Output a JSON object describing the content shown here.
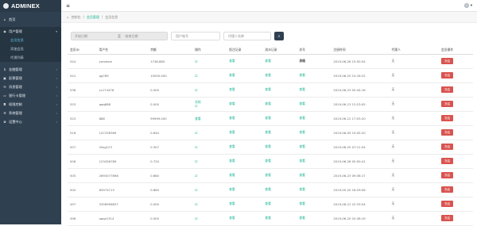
{
  "sidebar": {
    "logo": "ADMINEX",
    "items": [
      {
        "label": "首页",
        "icon": "home-icon",
        "glyph": "⌂"
      },
      {
        "label": "用户管理",
        "icon": "user-group-icon",
        "glyph": "◉",
        "chev": "▾"
      },
      {
        "label": "会员信息",
        "sub": true,
        "active": true
      },
      {
        "label": "添加会员",
        "sub": true
      },
      {
        "label": "代理列表",
        "sub": true
      },
      {
        "label": "金融管理",
        "icon": "dollar-icon",
        "glyph": "$",
        "chev": "‹"
      },
      {
        "label": "彩票管理",
        "icon": "lottery-icon",
        "glyph": "▣",
        "chev": "‹"
      },
      {
        "label": "消息管理",
        "icon": "message-icon",
        "glyph": "✉",
        "chev": "‹"
      },
      {
        "label": "银行卡管理",
        "icon": "card-icon",
        "glyph": "▭",
        "chev": "‹"
      },
      {
        "label": "权限控制",
        "icon": "lock-icon",
        "glyph": "◘",
        "chev": "‹"
      },
      {
        "label": "系统管理",
        "icon": "gear-icon",
        "glyph": "⚙",
        "chev": "‹"
      },
      {
        "label": "设置中心",
        "icon": "settings-icon",
        "glyph": "✿",
        "chev": "‹"
      }
    ]
  },
  "topbar": {
    "menu_glyph": "≡",
    "user_glyph": "▾"
  },
  "breadcrumb": {
    "home": "控制台",
    "sep": "/",
    "level1": "会员管理",
    "level2": "会员信息"
  },
  "filters": {
    "start": "开始日期",
    "to": "至",
    "end": "结束日期",
    "username_placeholder": "用户账号",
    "agent_placeholder": "代理人名称",
    "search_glyph": "⌕"
  },
  "table": {
    "headers": [
      "会员ID",
      "用户名",
      "余额",
      "操作",
      "投注记录",
      "流水记录",
      "冻号",
      "注册时间",
      "代理人",
      "会员操作"
    ],
    "rows": [
      {
        "id": "544",
        "user": "zxcxbsm",
        "bal": "1746.880",
        "op": "☑",
        "bet": "查看",
        "flow": "查看",
        "status": "冻结",
        "time": "2019-06-26 15:50:54",
        "agent": "无",
        "act": "冻结"
      },
      {
        "id": "541",
        "user": "qg789",
        "bal": "10000.000",
        "op": "☑",
        "bet": "查看",
        "flow": "查看",
        "status": "查看",
        "time": "2019-06-25 15:16:22",
        "agent": "无",
        "act": "冻结"
      },
      {
        "id": "538",
        "user": "cc174476",
        "bal": "0.000",
        "op": "☑",
        "bet": "查看",
        "flow": "查看",
        "status": "查看",
        "time": "2019-06-23 05:44:16",
        "agent": "无",
        "act": "冻结"
      },
      {
        "id": "525",
        "user": "qqq888",
        "bal": "0.000",
        "op": "冻结",
        "op2": "☑",
        "bet": "查看",
        "flow": "查看",
        "status": "查看",
        "time": "2019-06-13 13:23:05",
        "agent": "无",
        "act": "冻结"
      },
      {
        "id": "523",
        "user": "888",
        "bal": "99999.000",
        "op": "查看",
        "op2": "",
        "bet": "查看",
        "flow": "查看",
        "status": "查看",
        "time": "2019-06-12 17:03:20",
        "agent": "无",
        "act": "冻结"
      },
      {
        "id": "516",
        "user": "147258369",
        "bal": "0.640",
        "op": "☑",
        "bet": "查看",
        "flow": "查看",
        "status": "查看",
        "time": "2019-06-05 19:45:20",
        "agent": "无",
        "act": "冻结"
      },
      {
        "id": "507",
        "user": "liling123",
        "bal": "0.307",
        "op": "☑",
        "bet": "查看",
        "flow": "查看",
        "status": "查看",
        "time": "2019-06-25 07:11:54",
        "agent": "无",
        "act": "冻结"
      },
      {
        "id": "506",
        "user": "123456789",
        "bal": "0.720",
        "op": "☑",
        "bet": "查看",
        "flow": "查看",
        "status": "查看",
        "time": "2019-06-26 05:50:41",
        "agent": "无",
        "act": "冻结"
      },
      {
        "id": "505",
        "user": "2693077898",
        "bal": "0.680",
        "op": "☑",
        "bet": "查看",
        "flow": "查看",
        "status": "查看",
        "time": "2019-06-23 09:38:17",
        "agent": "无",
        "act": "冻结"
      },
      {
        "id": "500",
        "user": "65974715",
        "bal": "0.860",
        "op": "☑",
        "bet": "查看",
        "flow": "查看",
        "status": "查看",
        "time": "2019-05-20 18:29:06",
        "agent": "无",
        "act": "冻结"
      },
      {
        "id": "497",
        "user": "3358956837",
        "bal": "0.000",
        "op": "☑",
        "bet": "查看",
        "flow": "查看",
        "status": "查看",
        "time": "2019-06-21 22:33:54",
        "agent": "无",
        "act": "冻结"
      },
      {
        "id": "496",
        "user": "oqqz1314",
        "bal": "0.000",
        "op": "☑",
        "bet": "查看",
        "flow": "查看",
        "status": "查看",
        "time": "2019-06-20 20:38:19",
        "agent": "无",
        "act": "冻结"
      }
    ]
  }
}
